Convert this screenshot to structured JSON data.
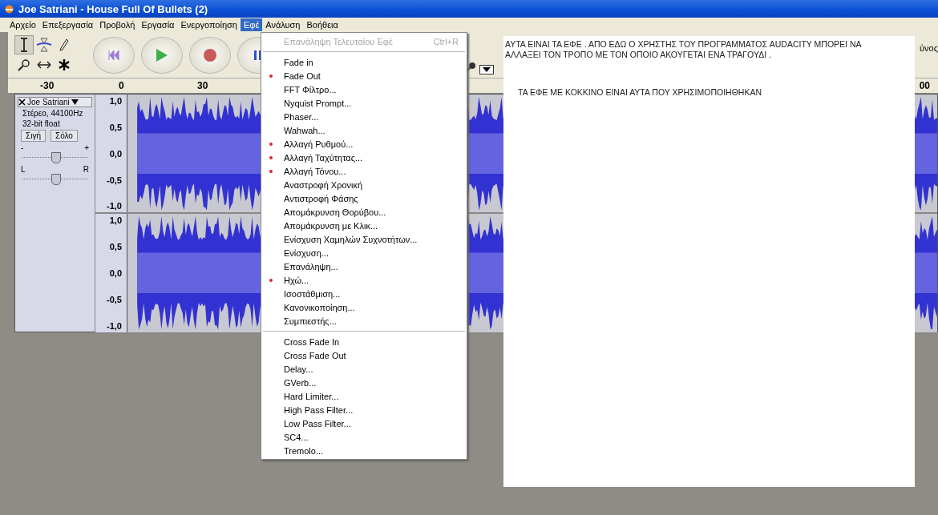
{
  "window": {
    "title": "Joe Satriani - House Full Of Bullets (2)"
  },
  "menu_bar": [
    {
      "label": "Αρχείο",
      "selected": false
    },
    {
      "label": "Επεξεργασία",
      "selected": false
    },
    {
      "label": "Προβολή",
      "selected": false
    },
    {
      "label": "Εργασία",
      "selected": false
    },
    {
      "label": "Ενεργοποίηση",
      "selected": false
    },
    {
      "label": "Εφέ",
      "selected": true
    },
    {
      "label": "Ανάλυση",
      "selected": false
    },
    {
      "label": "Βοήθεια",
      "selected": false
    }
  ],
  "toolbar": {
    "edge_label": "ύνος"
  },
  "ruler": {
    "labels": [
      "-30",
      "0",
      "30"
    ],
    "edge_label": "00"
  },
  "track": {
    "name": "Joe Satriani",
    "info": [
      "Στέρεο, 44100Hz",
      "32-bit float"
    ],
    "buttons": [
      "Σιγή",
      "Σόλο"
    ],
    "gain": {
      "min_label": "-",
      "max_label": "+",
      "level": 0.5
    },
    "pan": {
      "min_label": "L",
      "max_label": "R",
      "level": 0.5
    },
    "channels": [
      {
        "scale": [
          "1,0",
          "0,5",
          "0,0",
          "-0,5",
          "-1,0"
        ]
      },
      {
        "scale": [
          "1,0",
          "0,5",
          "0,0",
          "-0,5",
          "-1,0"
        ]
      }
    ]
  },
  "effects_menu": {
    "items": [
      {
        "kind": "item",
        "label": "Επανάληψη Τελευταίου Εφέ",
        "shortcut": "Ctrl+R",
        "disabled": true,
        "marked": false
      },
      {
        "kind": "separator"
      },
      {
        "kind": "item",
        "label": "Fade in",
        "disabled": false,
        "marked": false
      },
      {
        "kind": "item",
        "label": "Fade Out",
        "disabled": false,
        "marked": true
      },
      {
        "kind": "item",
        "label": "FFT Φίλτρο...",
        "disabled": false,
        "marked": false
      },
      {
        "kind": "item",
        "label": "Nyquist Prompt...",
        "disabled": false,
        "marked": false
      },
      {
        "kind": "item",
        "label": "Phaser...",
        "disabled": false,
        "marked": false
      },
      {
        "kind": "item",
        "label": "Wahwah...",
        "disabled": false,
        "marked": false
      },
      {
        "kind": "item",
        "label": "Αλλαγή Ρυθμού...",
        "disabled": false,
        "marked": true
      },
      {
        "kind": "item",
        "label": "Αλλαγή Ταχύτητας...",
        "disabled": false,
        "marked": true
      },
      {
        "kind": "item",
        "label": "Αλλαγή Τόνου...",
        "disabled": false,
        "marked": true
      },
      {
        "kind": "item",
        "label": "Αναστροφή Χρονική",
        "disabled": false,
        "marked": false
      },
      {
        "kind": "item",
        "label": "Αντιστροφή Φάσης",
        "disabled": false,
        "marked": false
      },
      {
        "kind": "item",
        "label": "Απομάκρυνση Θορύβου...",
        "disabled": false,
        "marked": false
      },
      {
        "kind": "item",
        "label": "Απομάκρυνση με Κλικ...",
        "disabled": false,
        "marked": false
      },
      {
        "kind": "item",
        "label": "Ενίσχυση Χαμηλών Συχνοτήτων...",
        "disabled": false,
        "marked": false
      },
      {
        "kind": "item",
        "label": "Ενίσχυση...",
        "disabled": false,
        "marked": false
      },
      {
        "kind": "item",
        "label": "Επανάληψη...",
        "disabled": false,
        "marked": false
      },
      {
        "kind": "item",
        "label": "Ηχώ...",
        "disabled": false,
        "marked": true
      },
      {
        "kind": "item",
        "label": "Ισοστάθμιση...",
        "disabled": false,
        "marked": false
      },
      {
        "kind": "item",
        "label": "Κανονικοποίηση...",
        "disabled": false,
        "marked": false
      },
      {
        "kind": "item",
        "label": "Συμπιεστής...",
        "disabled": false,
        "marked": false
      },
      {
        "kind": "separator"
      },
      {
        "kind": "item",
        "label": "Cross Fade In",
        "disabled": false,
        "marked": false
      },
      {
        "kind": "item",
        "label": "Cross Fade Out",
        "disabled": false,
        "marked": false
      },
      {
        "kind": "item",
        "label": "Delay...",
        "disabled": false,
        "marked": false
      },
      {
        "kind": "item",
        "label": "GVerb...",
        "disabled": false,
        "marked": false
      },
      {
        "kind": "item",
        "label": "Hard Limiter...",
        "disabled": false,
        "marked": false
      },
      {
        "kind": "item",
        "label": "High Pass Filter...",
        "disabled": false,
        "marked": false
      },
      {
        "kind": "item",
        "label": "Low Pass Filter...",
        "disabled": false,
        "marked": false
      },
      {
        "kind": "item",
        "label": "SC4...",
        "disabled": false,
        "marked": false
      },
      {
        "kind": "item",
        "label": "Tremolo...",
        "disabled": false,
        "marked": false
      }
    ]
  },
  "note": {
    "paragraphs": [
      "ΑΥΤΑ ΕΙΝΑΙ ΤΑ ΕΦΕ .  ΑΠΟ ΕΔΩ Ο ΧΡΗΣΤΗΣ ΤΟΥ ΠΡΟΓΡΑΜΜΑΤΟΣ AUDACITY ΜΠΟΡΕΙ  ΝΑ ΑΛΛΑΞΕΙ ΤΟΝ ΤΡΟΠΟ ΜΕ ΤΟΝ ΟΠΟΙΟ ΑΚΟΥΓΕΤΑΙ ΕΝΑ ΤΡΑΓΟΥΔΙ .",
      "ΤΑ ΕΦΕ ΜΕ ΚΟΚΚΙΝΟ ΕΙΝΑΙ ΑΥΤΑ ΠΟΥ ΧΡΗΣΙΜΟΠΟΙΗΘΗΚΑΝ"
    ]
  }
}
